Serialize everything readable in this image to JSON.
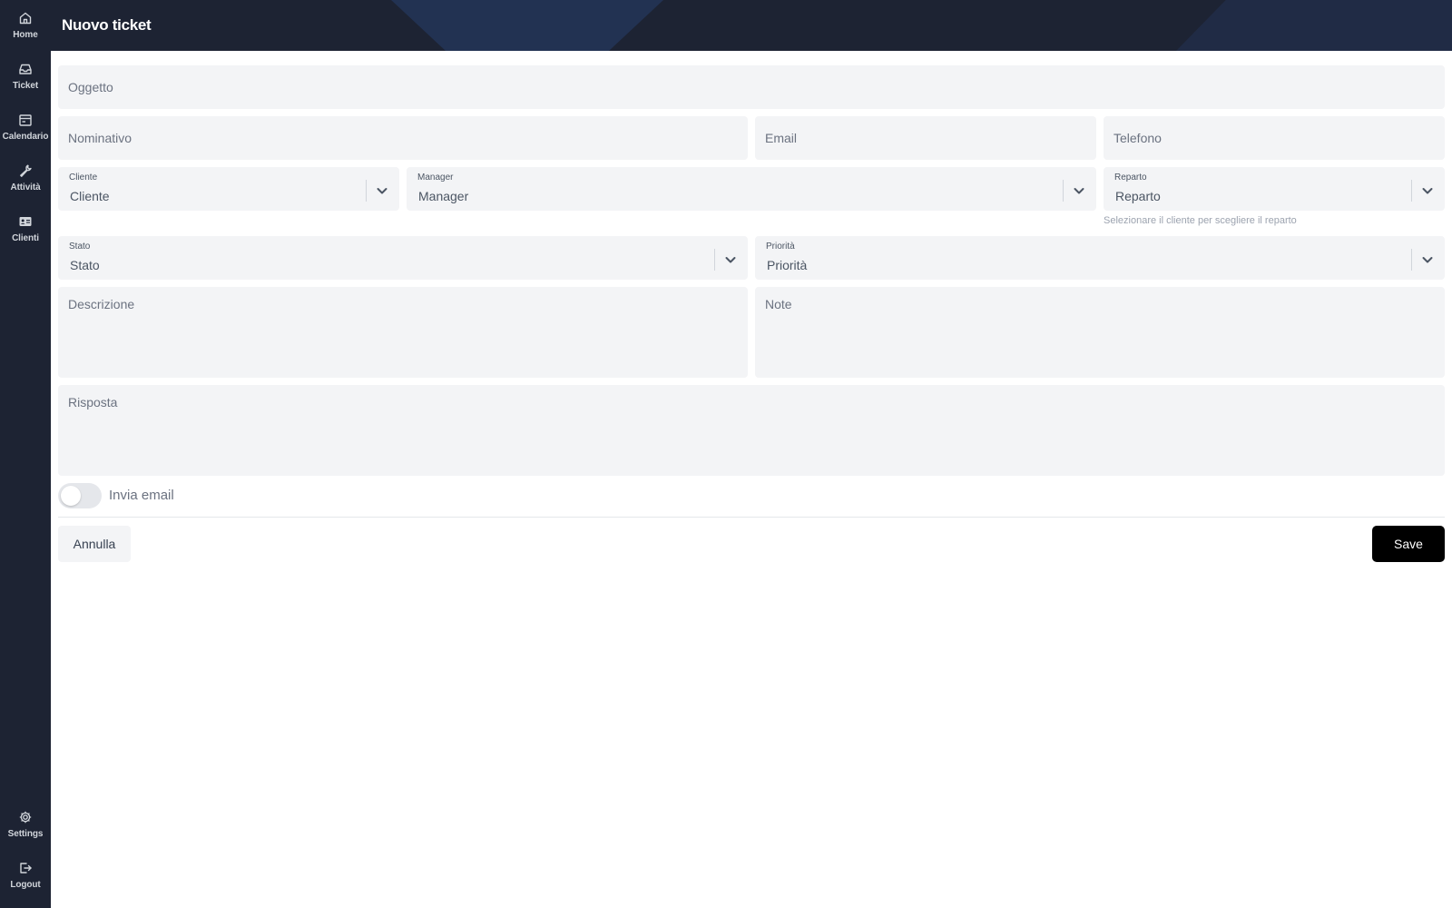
{
  "sidebar": {
    "items": [
      {
        "label": "Home",
        "icon": "home-icon"
      },
      {
        "label": "Ticket",
        "icon": "inbox-icon"
      },
      {
        "label": "Calendario",
        "icon": "calendar-icon"
      },
      {
        "label": "Attività",
        "icon": "wrench-icon"
      },
      {
        "label": "Clienti",
        "icon": "id-card-icon"
      }
    ],
    "bottom": [
      {
        "label": "Settings",
        "icon": "gear-icon"
      },
      {
        "label": "Logout",
        "icon": "logout-icon"
      }
    ]
  },
  "header": {
    "title": "Nuovo ticket"
  },
  "form": {
    "oggetto": {
      "placeholder": "Oggetto"
    },
    "nominativo": {
      "placeholder": "Nominativo"
    },
    "email": {
      "placeholder": "Email"
    },
    "telefono": {
      "placeholder": "Telefono"
    },
    "cliente": {
      "label": "Cliente",
      "value": "Cliente"
    },
    "manager": {
      "label": "Manager",
      "value": "Manager"
    },
    "reparto": {
      "label": "Reparto",
      "value": "Reparto",
      "helper": "Selezionare il cliente per scegliere il reparto"
    },
    "stato": {
      "label": "Stato",
      "value": "Stato"
    },
    "priorita": {
      "label": "Priorità",
      "value": "Priorità"
    },
    "descrizione": {
      "placeholder": "Descrizione"
    },
    "note": {
      "placeholder": "Note"
    },
    "risposta": {
      "placeholder": "Risposta"
    },
    "invia_email": {
      "label": "Invia email",
      "checked": false
    }
  },
  "actions": {
    "cancel_label": "Annulla",
    "save_label": "Save"
  },
  "colors": {
    "sidebar_bg": "#1d2333",
    "field_bg": "#f3f4f6",
    "save_bg": "#000000"
  }
}
